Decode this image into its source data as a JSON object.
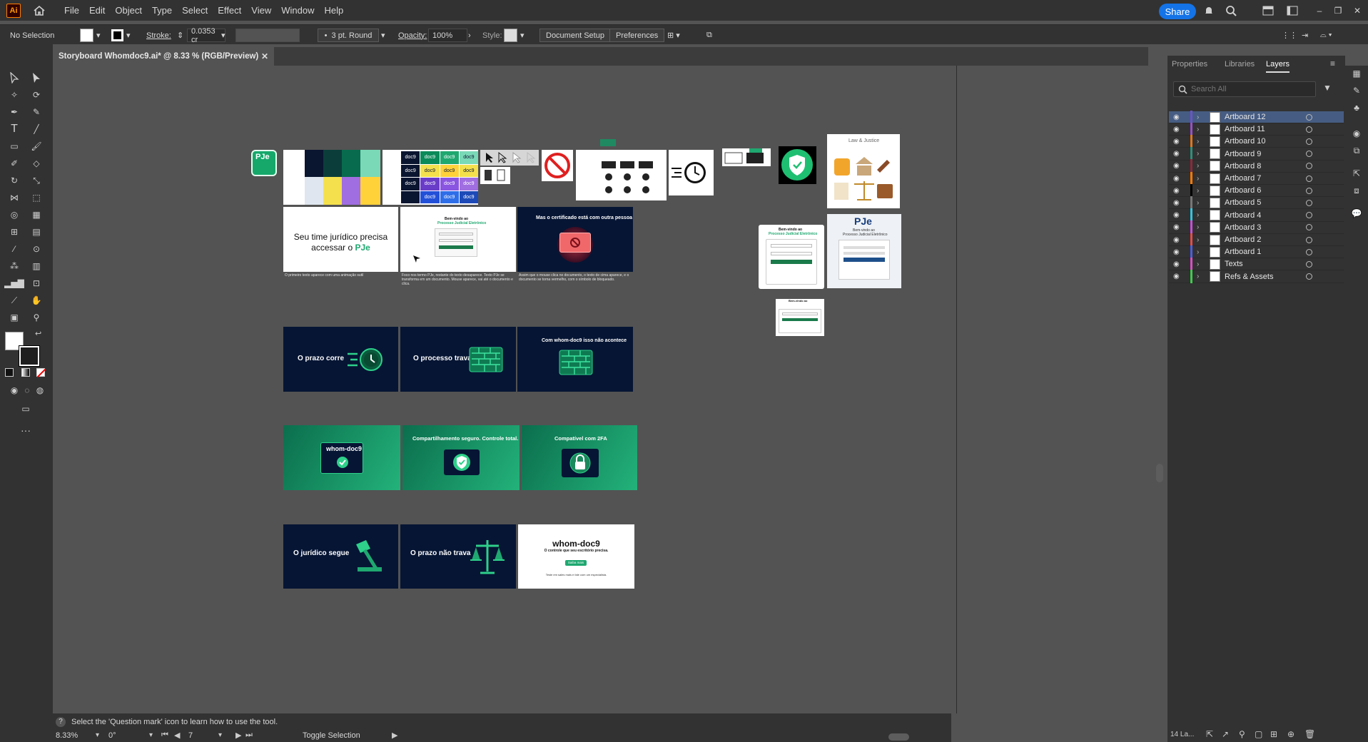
{
  "app": {
    "logo": "Ai"
  },
  "menu": [
    "File",
    "Edit",
    "Object",
    "Type",
    "Select",
    "Effect",
    "View",
    "Window",
    "Help"
  ],
  "share_label": "Share",
  "control": {
    "selection": "No Selection",
    "stroke_label": "Stroke:",
    "stroke_value": "0.0353 cr",
    "brush": "3 pt. Round",
    "opacity_label": "Opacity:",
    "opacity_value": "100%",
    "style_label": "Style:",
    "doc_setup": "Document Setup",
    "preferences": "Preferences"
  },
  "document_tab": "Storyboard Whomdoc9.ai* @ 8.33 % (RGB/Preview)",
  "panel": {
    "tabs": [
      "Properties",
      "Libraries",
      "Layers"
    ],
    "active_tab": "Layers",
    "search_placeholder": "Search All",
    "layers": [
      {
        "name": "Artboard 12",
        "color": "#6a54c7",
        "selected": true
      },
      {
        "name": "Artboard 11",
        "color": "#9650c8"
      },
      {
        "name": "Artboard 10",
        "color": "#e2761b"
      },
      {
        "name": "Artboard 9",
        "color": "#2f8f7a"
      },
      {
        "name": "Artboard 8",
        "color": "#8c2a3a"
      },
      {
        "name": "Artboard 7",
        "color": "#ff7a00"
      },
      {
        "name": "Artboard 6",
        "color": "#000000"
      },
      {
        "name": "Artboard 5",
        "color": "#777777"
      },
      {
        "name": "Artboard 4",
        "color": "#33c5e0"
      },
      {
        "name": "Artboard 3",
        "color": "#c74fd8"
      },
      {
        "name": "Artboard 2",
        "color": "#e84a4a"
      },
      {
        "name": "Artboard 1",
        "color": "#4a5fe0"
      },
      {
        "name": "Texts",
        "color": "#d84fc4"
      },
      {
        "name": "Refs & Assets",
        "color": "#3fcc4a"
      }
    ],
    "layer_count": "14 La..."
  },
  "status": {
    "hint": "Select the 'Question mark' icon to learn how to use the tool.",
    "zoom": "8.33%",
    "rotation": "0°",
    "artboard_num": "7",
    "toggle": "Toggle Selection"
  },
  "artboards": {
    "pje_logo": "PJe",
    "swatch_labels": [
      "doc9",
      "doc9",
      "doc9",
      "doc9",
      "doc9",
      "doc9",
      "doc9",
      "doc9",
      "doc9",
      "doc9",
      "doc9",
      "doc9",
      "doc9"
    ],
    "law_title": "Law & Justice",
    "welcome": "Bem-vindo ao",
    "pje_sub": "Processo Judicial Eletrônico",
    "ab1_text_a": "Seu time jurídico precisa",
    "ab1_text_b": "accessar o ",
    "ab1_highlight": "PJe",
    "ab1_cap": "O primeiro texto aparece com uma animação sutil",
    "ab2_cap": "Foco nos termo PJe, restante do texto desaparece. Texto PJe se transforma em um documento. Mouse aparece, vai até o documento e clica.",
    "ab3_title": "Mas o certificado está com outra pessoa",
    "ab3_cap": "Assim que o mouse clica no documento, o texto de cima aparece, e o documento se torna vermelho, com o símbolo de bloqueado.",
    "ab4_title": "O prazo corre",
    "ab5_title": "O processo",
    "ab5_bold": "trava",
    "ab6_pre": "Com ",
    "ab6_brand": "whom-doc9",
    "ab6_post": " isso não acontece",
    "ab7_brand": "whom-doc9",
    "ab8_title": "Compartilhamento seguro. Controle total.",
    "ab9_title": "Compatível com 2FA",
    "ab10_title": "O jurídico segue",
    "ab11_title": "O prazo não trava",
    "ab12_brand": "whom-doc9",
    "ab12_sub": "O controle que seu escritório precisa.",
    "ab12_btn": "Saiba mais",
    "ab12_foot": "Teste em sales mais e fale com um especialista."
  }
}
